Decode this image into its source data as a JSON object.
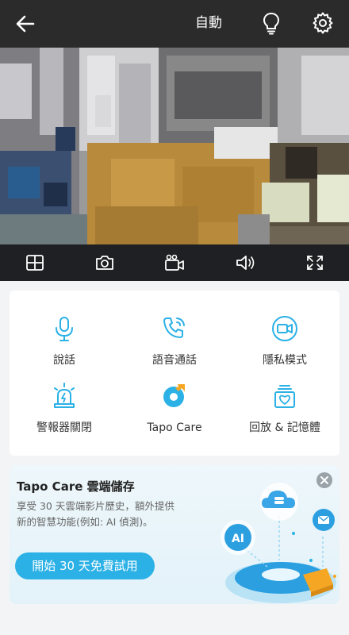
{
  "header": {
    "mode_label": "自動"
  },
  "icons": {
    "back": "back-arrow-icon",
    "bulb": "lightbulb-icon",
    "settings": "gear-icon",
    "grid": "grid-view-icon",
    "snapshot": "camera-icon",
    "record": "video-record-icon",
    "sound": "speaker-icon",
    "fullscreen": "fullscreen-icon"
  },
  "functions": [
    {
      "label": "說話",
      "icon": "microphone-icon"
    },
    {
      "label": "語音通話",
      "icon": "phone-call-icon"
    },
    {
      "label": "隱私模式",
      "icon": "privacy-camera-icon"
    },
    {
      "label": "警報器關閉",
      "icon": "alarm-light-icon"
    },
    {
      "label": "Tapo Care",
      "icon": "tapo-care-icon"
    },
    {
      "label": "回放 & 記憶體",
      "icon": "playback-icon"
    }
  ],
  "promo": {
    "title": "Tapo Care 雲端儲存",
    "description": "享受 30 天雲端影片歷史，額外提供新的智慧功能(例如: AI 偵測)。",
    "cta_label": "開始 30 天免費試用",
    "ai_badge": "AI"
  },
  "colors": {
    "accent": "#2bb1e6",
    "topbar": "#2b2b2b",
    "controlbar": "#1f2023"
  }
}
